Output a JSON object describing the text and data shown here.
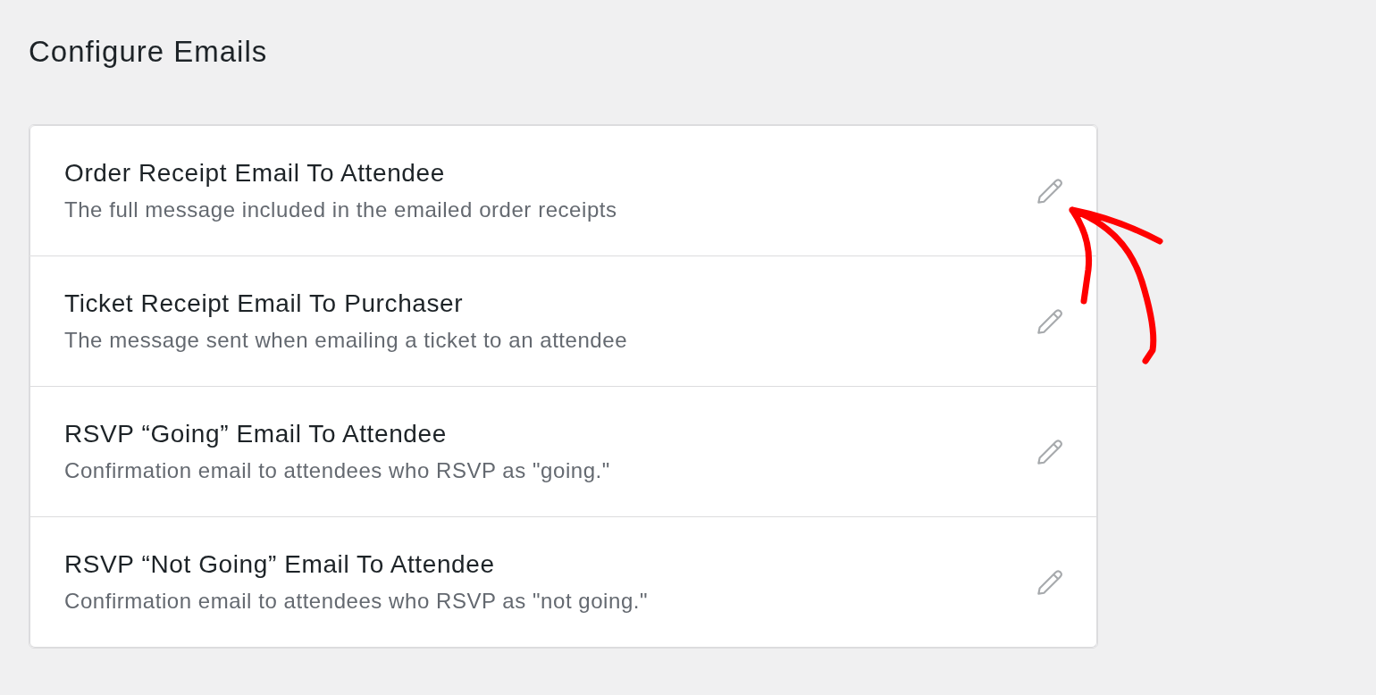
{
  "page": {
    "title": "Configure Emails"
  },
  "emails": [
    {
      "title": "Order Receipt Email To Attendee",
      "description": "The full message included in the emailed order receipts",
      "annotated": true
    },
    {
      "title": "Ticket Receipt Email To Purchaser",
      "description": "The message sent when emailing a ticket to an attendee",
      "annotated": false
    },
    {
      "title": "RSVP “Going” Email To Attendee",
      "description": "Confirmation email to attendees who RSVP as \"going.\"",
      "annotated": false
    },
    {
      "title": "RSVP “Not Going” Email To Attendee",
      "description": "Confirmation email to attendees who RSVP as \"not going.\"",
      "annotated": false
    }
  ]
}
